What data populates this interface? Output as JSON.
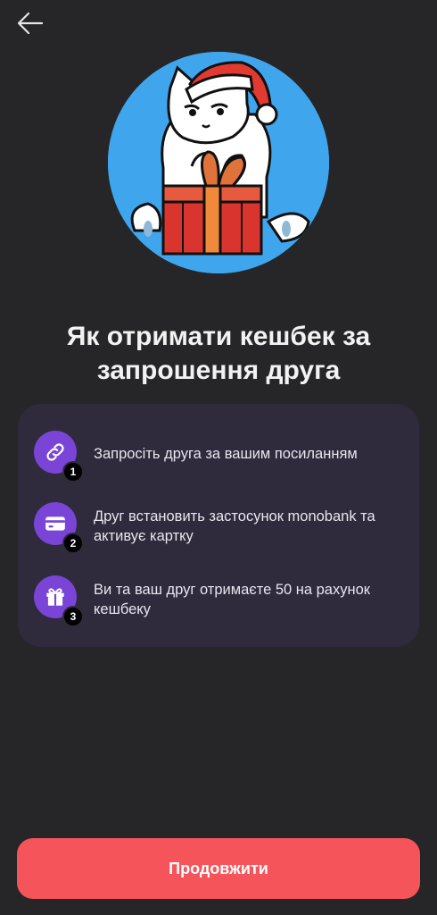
{
  "header": {
    "back_icon": "arrow-left-icon"
  },
  "illustration": {
    "subject": "cat-in-santa-hat-with-gift-icon",
    "bg_color": "#3fa6ee"
  },
  "title": "Як отримати кешбек за запрошення друга",
  "steps": [
    {
      "number": "1",
      "icon": "link-icon",
      "text": "Запросіть друга за вашим посиланням"
    },
    {
      "number": "2",
      "icon": "card-icon",
      "text": "Друг встановить застосунок monobank та активує картку"
    },
    {
      "number": "3",
      "icon": "gift-icon",
      "text": "Ви та ваш друг отримаєте 50 на рахунок кешбеку"
    }
  ],
  "footer": {
    "continue_label": "Продовжити"
  },
  "colors": {
    "background": "#262628",
    "card": "#2f2a3c",
    "accent_purple": "#7a45d6",
    "button_red": "#f6545b"
  }
}
